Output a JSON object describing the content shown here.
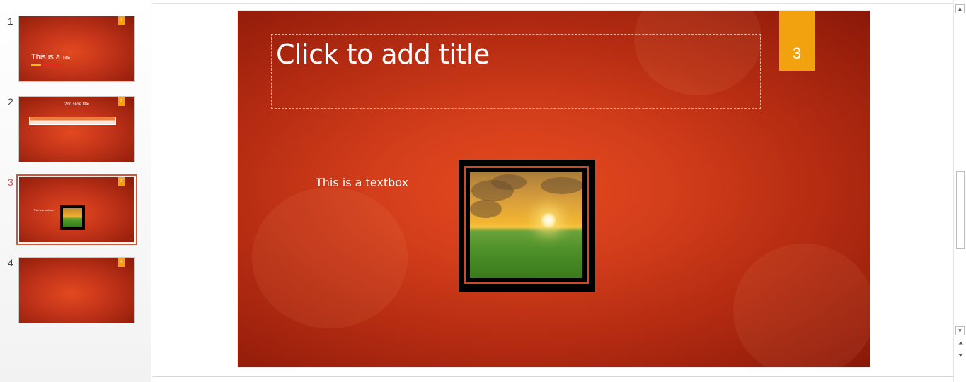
{
  "thumbnails": [
    {
      "number": "1",
      "tag": "1",
      "title_main": "This is a",
      "title_small": "Title"
    },
    {
      "number": "2",
      "tag": "2",
      "title": "2nd slide title"
    },
    {
      "number": "3",
      "tag": "3",
      "textbox": "This is a textbox",
      "selected": true
    },
    {
      "number": "4",
      "tag": "4"
    }
  ],
  "slide": {
    "number": "3",
    "title_placeholder": "Click to add title",
    "textbox": "This is a textbox",
    "picture": "sunset-over-grass-field"
  },
  "colors": {
    "slide_background": "#d33e1b",
    "slide_number_tag": "#f3a20f",
    "selected_thumbnail": "#d2553a",
    "picture_border": "#cf4a22"
  },
  "scrollbar": {
    "up_icon": "scroll-up-arrow-icon",
    "down_icon": "scroll-down-arrow-icon",
    "prev_icon": "previous-slide-icon",
    "next_icon": "next-slide-icon"
  }
}
